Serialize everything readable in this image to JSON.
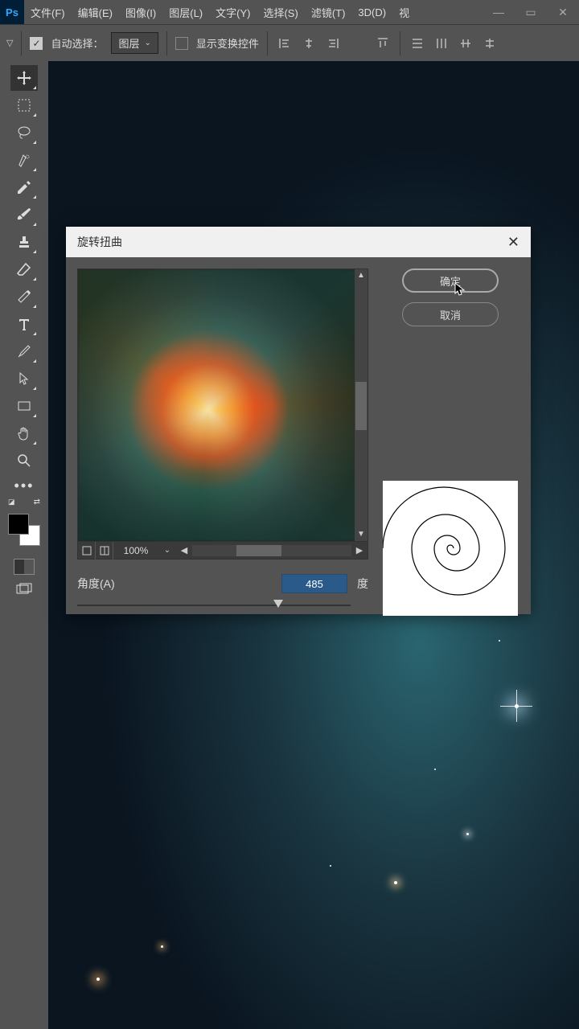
{
  "menubar": {
    "items": [
      "文件(F)",
      "编辑(E)",
      "图像(I)",
      "图层(L)",
      "文字(Y)",
      "选择(S)",
      "滤镜(T)",
      "3D(D)",
      "视"
    ]
  },
  "optbar": {
    "auto_select": "自动选择：",
    "layer": "图层",
    "show_transform": "显示变换控件"
  },
  "dialog": {
    "title": "旋转扭曲",
    "zoom": "100%",
    "angle_label": "角度(A)",
    "angle_value": "485",
    "angle_unit": "度",
    "ok": "确定",
    "cancel": "取消"
  }
}
